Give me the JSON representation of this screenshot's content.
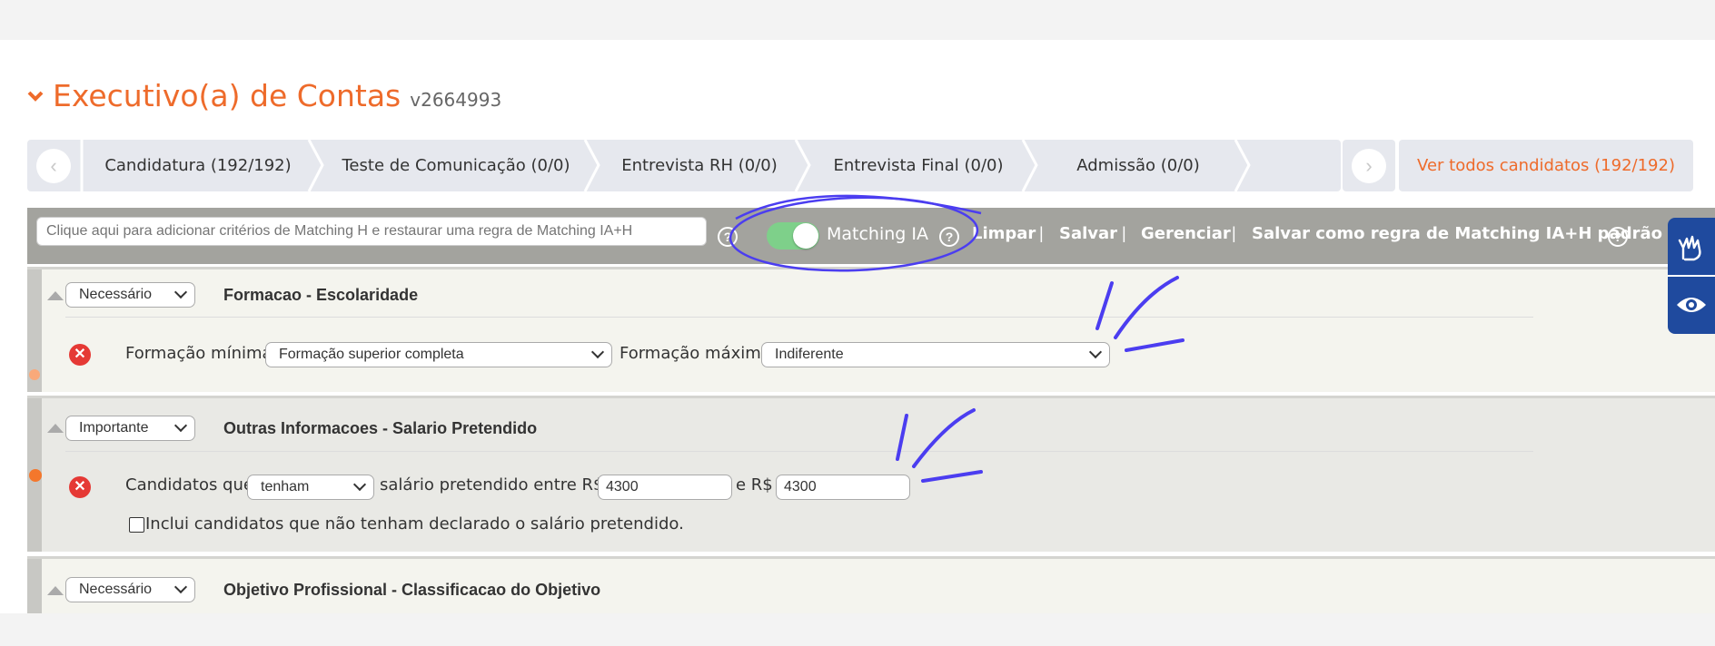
{
  "header": {
    "title": "Executivo(a) de Contas",
    "job_code": "v2664993"
  },
  "pipeline": {
    "stages": [
      {
        "label": "Candidatura (192/192)"
      },
      {
        "label": "Teste de Comunicação (0/0)"
      },
      {
        "label": "Entrevista RH (0/0)"
      },
      {
        "label": "Entrevista Final (0/0)"
      },
      {
        "label": "Admissão (0/0)"
      }
    ],
    "view_all_label": "Ver todos candidatos (192/192)"
  },
  "toolbar": {
    "criteria_placeholder": "Clique aqui para adicionar critérios de Matching H e restaurar uma regra de Matching IA+H",
    "toggle_label": "Matching IA",
    "toggle_on": true,
    "links": [
      "Limpar",
      "Salvar",
      "Gerenciar",
      "Salvar como regra de Matching IA+H padrão"
    ],
    "separator": "|",
    "help_glyph": "?"
  },
  "criteria": [
    {
      "priority": "Necessário",
      "title": "Formacao - Escolaridade",
      "min_label": "Formação mínima",
      "min_value": "Formação superior completa",
      "max_label": "Formação máxima",
      "max_value": "Indiferente"
    },
    {
      "priority": "Importante",
      "title": "Outras Informacoes - Salario Pretendido",
      "prefix": "Candidatos que",
      "condition": "tenham",
      "middle": "salário pretendido entre R$",
      "from_value": "4300",
      "and_label": "e R$",
      "to_value": "4300",
      "checkbox_label": "Inclui candidatos que não tenham declarado o salário pretendido."
    },
    {
      "priority": "Necessário",
      "title": "Objetivo Profissional - Classificacao do Objetivo"
    }
  ],
  "colors": {
    "accent": "#ee6b2b",
    "toolbar": "#a3a39e",
    "toggle": "#7ed08a",
    "a11y": "#1f4a9e",
    "annotation": "#4b3df0"
  },
  "icons": [
    "chevron-down-icon",
    "chevron-left-icon",
    "chevron-right-icon",
    "help-icon",
    "remove-icon",
    "sign-language-icon",
    "eye-icon",
    "triangle-up-icon"
  ]
}
